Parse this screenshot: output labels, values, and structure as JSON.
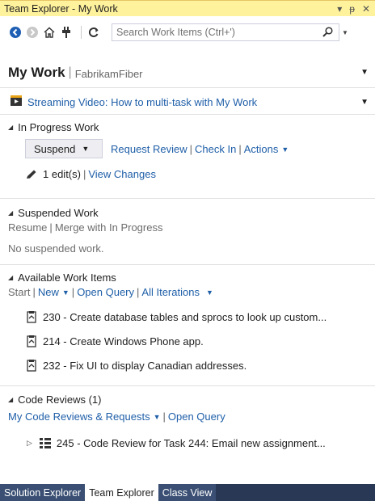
{
  "window": {
    "title": "Team Explorer - My Work",
    "controls": [
      "▾",
      "ᵽ",
      "✕"
    ]
  },
  "toolbar": {
    "search_placeholder": "Search Work Items (Ctrl+')"
  },
  "header": {
    "title": "My Work",
    "subtitle": "FabrikamFiber"
  },
  "banner": {
    "link": "Streaming Video: How to multi-task with My Work"
  },
  "in_progress": {
    "heading": "In Progress Work",
    "suspend_label": "Suspend",
    "links": [
      "Request Review",
      "Check In",
      "Actions"
    ],
    "edits_label": "1 edit(s)",
    "view_changes": "View Changes"
  },
  "suspended": {
    "heading": "Suspended Work",
    "resume": "Resume",
    "merge": "Merge with In Progress",
    "empty": "No suspended work."
  },
  "available": {
    "heading": "Available Work Items",
    "start": "Start",
    "new": "New",
    "open_query": "Open Query",
    "all_iterations": "All Iterations",
    "items": [
      "230 - Create database tables and sprocs to look up custom...",
      "214 - Create Windows Phone app.",
      "232 - Fix UI to display Canadian addresses."
    ]
  },
  "code_reviews": {
    "heading": "Code Reviews (1)",
    "my_reviews": "My Code Reviews & Requests",
    "open_query": "Open Query",
    "item": "245 - Code Review for Task 244: Email new assignment..."
  },
  "tabs": [
    "Solution Explorer",
    "Team Explorer",
    "Class View"
  ],
  "colors": {
    "title_bar": "#fff29d",
    "link": "#1f5fa8",
    "tab_strip": "#293955"
  }
}
